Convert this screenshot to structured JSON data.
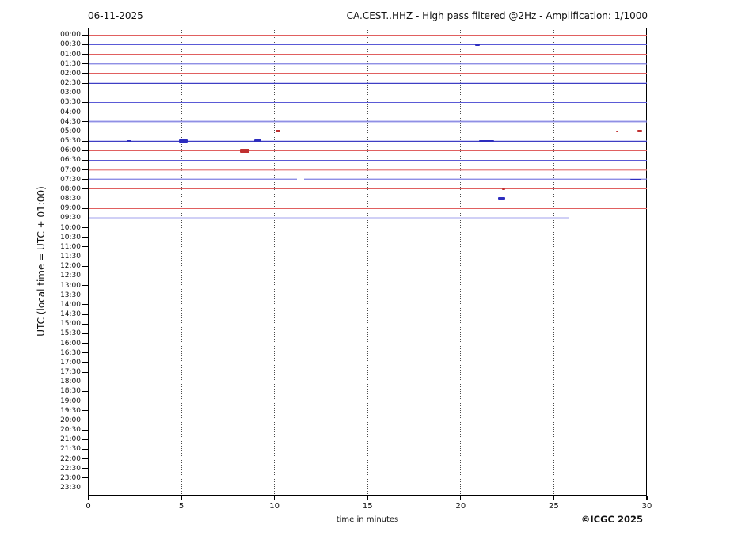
{
  "chart_data": {
    "type": "line",
    "subtype": "helicorder-seismogram",
    "date": "06-11-2025",
    "title": "CA.CEST..HHZ - High pass filtered @2Hz - Amplification: 1/1000",
    "xlabel": "time in minutes",
    "ylabel": "UTC (local time = UTC + 01:00)",
    "credit": "©ICGC 2025",
    "xlim": [
      0,
      30
    ],
    "x_ticks": [
      0,
      5,
      10,
      15,
      20,
      25,
      30
    ],
    "x_gridlines": [
      5,
      10,
      15,
      20,
      25
    ],
    "grid": "dotted-vertical",
    "legend": "none",
    "y_tick_labels": [
      "00:00",
      "00:30",
      "01:00",
      "01:30",
      "02:00",
      "02:30",
      "03:00",
      "03:30",
      "04:00",
      "04:30",
      "05:00",
      "05:30",
      "06:00",
      "06:30",
      "07:00",
      "07:30",
      "08:00",
      "08:30",
      "09:00",
      "09:30",
      "10:00",
      "10:30",
      "11:00",
      "11:30",
      "12:00",
      "12:30",
      "13:00",
      "13:30",
      "14:00",
      "14:30",
      "15:00",
      "15:30",
      "16:00",
      "16:30",
      "17:00",
      "17:30",
      "18:00",
      "18:30",
      "19:00",
      "19:30",
      "20:00",
      "20:30",
      "21:00",
      "21:30",
      "22:00",
      "22:30",
      "23:00",
      "23:30"
    ],
    "colors": {
      "hour_rows": "#e06060",
      "half_hour_rows": "#5a5ad6",
      "event_red": "#c03030",
      "event_blue": "#2d2dbe",
      "gridline": "#4a4a4a"
    },
    "traces": [
      {
        "utc": "00:00",
        "color": "red",
        "style": "normal",
        "segments": [
          [
            0,
            30
          ]
        ],
        "events": []
      },
      {
        "utc": "00:30",
        "color": "blue",
        "style": "normal",
        "segments": [
          [
            0,
            30
          ]
        ],
        "events": [
          {
            "at": 20.9,
            "size": "small"
          }
        ]
      },
      {
        "utc": "01:00",
        "color": "red",
        "style": "normal",
        "segments": [
          [
            0,
            30
          ]
        ],
        "events": []
      },
      {
        "utc": "01:30",
        "color": "blue",
        "style": "fuzzy",
        "segments": [
          [
            0,
            30
          ]
        ],
        "events": []
      },
      {
        "utc": "02:00",
        "color": "red",
        "style": "normal",
        "segments": [
          [
            0,
            30
          ]
        ],
        "events": []
      },
      {
        "utc": "02:30",
        "color": "blue",
        "style": "dark",
        "segments": [
          [
            0,
            30
          ]
        ],
        "events": []
      },
      {
        "utc": "03:00",
        "color": "red",
        "style": "normal",
        "segments": [
          [
            0,
            30
          ]
        ],
        "events": []
      },
      {
        "utc": "03:30",
        "color": "blue",
        "style": "normal",
        "segments": [
          [
            0,
            30
          ]
        ],
        "events": []
      },
      {
        "utc": "04:00",
        "color": "red",
        "style": "normal",
        "segments": [
          [
            0,
            30
          ]
        ],
        "events": []
      },
      {
        "utc": "04:30",
        "color": "blue",
        "style": "fuzzy",
        "segments": [
          [
            0,
            30
          ]
        ],
        "events": []
      },
      {
        "utc": "05:00",
        "color": "red",
        "style": "normal",
        "segments": [
          [
            0,
            30
          ]
        ],
        "events": [
          {
            "at": 10.2,
            "size": "small"
          },
          {
            "at": 28.4,
            "size": "tiny"
          },
          {
            "at": 29.6,
            "size": "small"
          }
        ]
      },
      {
        "utc": "05:30",
        "color": "blue",
        "style": "dark",
        "segments": [
          [
            0,
            30
          ]
        ],
        "events": [
          {
            "at": 2.2,
            "size": "small"
          },
          {
            "at": 5.1,
            "size": "large"
          },
          {
            "at": 9.1,
            "size": "medium"
          },
          {
            "from": 21.0,
            "to": 21.8,
            "size": "band"
          }
        ]
      },
      {
        "utc": "06:00",
        "color": "red",
        "style": "normal",
        "segments": [
          [
            0,
            30
          ]
        ],
        "events": [
          {
            "at": 8.4,
            "size": "large"
          }
        ]
      },
      {
        "utc": "06:30",
        "color": "blue",
        "style": "normal",
        "segments": [
          [
            0,
            30
          ]
        ],
        "events": []
      },
      {
        "utc": "07:00",
        "color": "red",
        "style": "fuzzy",
        "segments": [
          [
            0,
            30
          ]
        ],
        "events": []
      },
      {
        "utc": "07:30",
        "color": "blue",
        "style": "fuzzy",
        "segments": [
          [
            0,
            11.2
          ],
          [
            11.6,
            30
          ]
        ],
        "events": [
          {
            "from": 29.1,
            "to": 29.7,
            "size": "band"
          }
        ]
      },
      {
        "utc": "08:00",
        "color": "red",
        "style": "normal",
        "segments": [
          [
            0,
            30
          ]
        ],
        "events": [
          {
            "at": 22.3,
            "size": "tiny"
          }
        ]
      },
      {
        "utc": "08:30",
        "color": "blue",
        "style": "normal",
        "segments": [
          [
            0,
            30
          ]
        ],
        "events": [
          {
            "at": 22.2,
            "size": "medium"
          }
        ]
      },
      {
        "utc": "09:00",
        "color": "red",
        "style": "normal",
        "segments": [
          [
            0,
            30
          ]
        ],
        "events": []
      },
      {
        "utc": "09:30",
        "color": "blue",
        "style": "fuzzy",
        "segments": [
          [
            0,
            25.8
          ]
        ],
        "events": []
      }
    ]
  }
}
